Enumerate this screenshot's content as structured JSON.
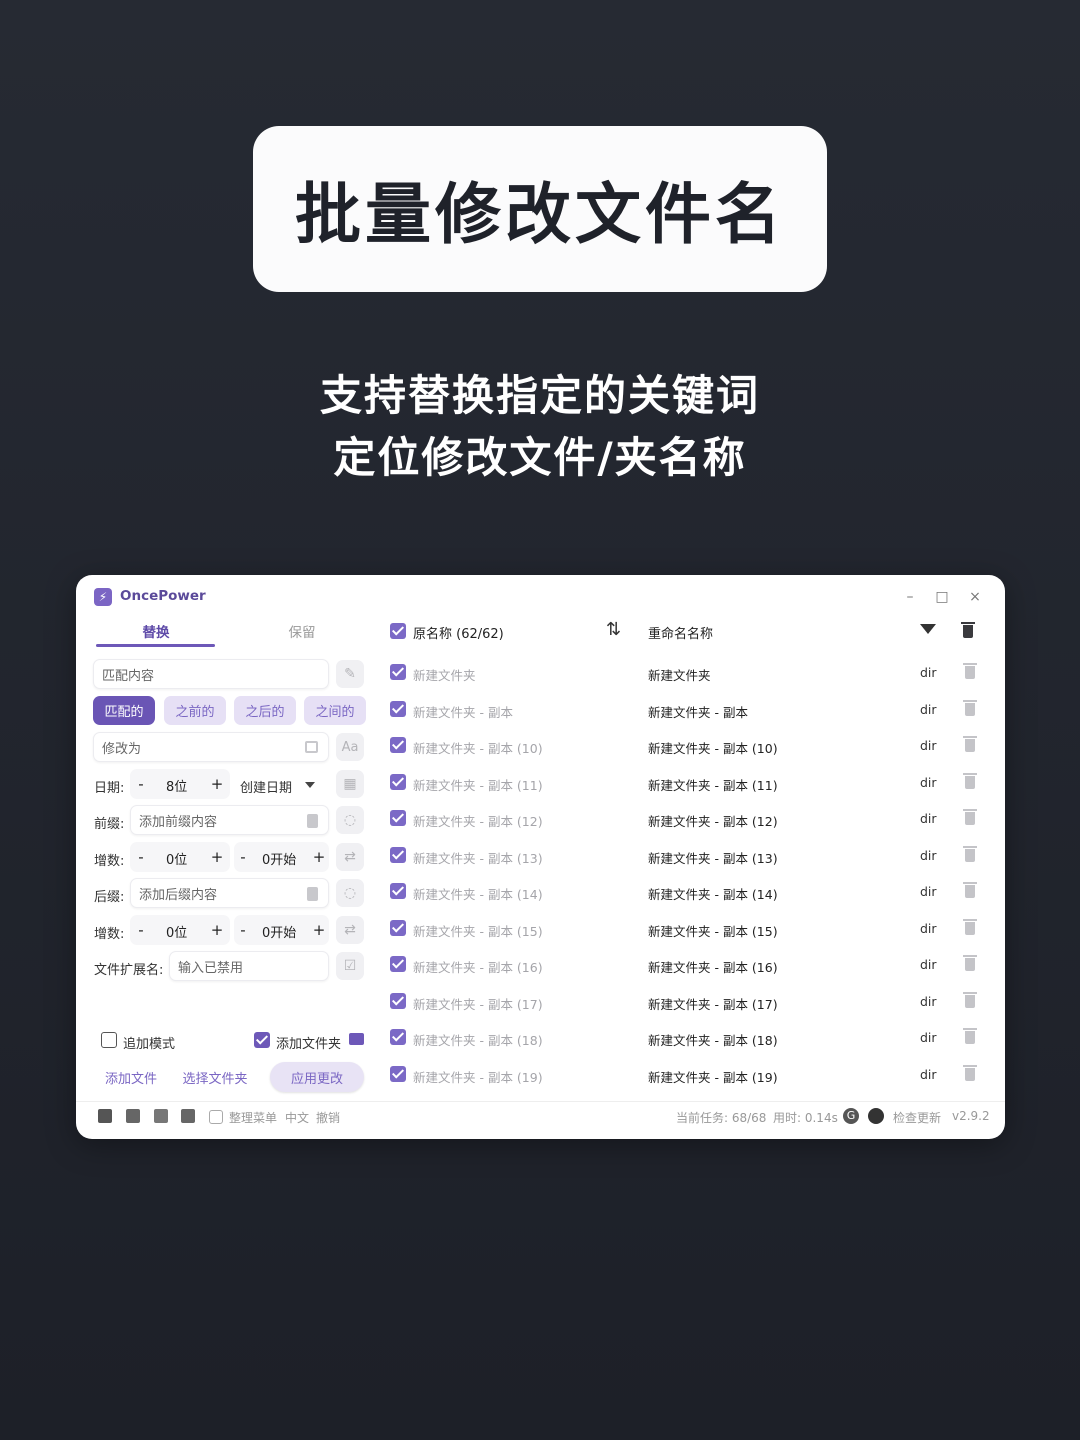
{
  "hero": {
    "title": "批量修改文件名"
  },
  "subtitle": {
    "line1": "支持替换指定的关键词",
    "line2": "定位修改文件/夹名称"
  },
  "app": {
    "name": "OncePower",
    "window_controls": {
      "minimize": "–",
      "maximize": "□",
      "close": "×"
    },
    "tabs": {
      "replace": "替换",
      "keep": "保留"
    },
    "match_input": {
      "placeholder": "匹配内容"
    },
    "segments": [
      "匹配的",
      "之前的",
      "之后的",
      "之间的"
    ],
    "modify_input": {
      "placeholder": "修改为"
    },
    "case_button": "Aa",
    "date": {
      "label": "日期:",
      "minus": "-",
      "value": "8位",
      "plus": "+",
      "select": "创建日期"
    },
    "prefix": {
      "label": "前缀:",
      "placeholder": "添加前缀内容"
    },
    "prefix_incr": {
      "label": "增数:",
      "minus": "-",
      "digits": "0位",
      "plus": "+",
      "minus2": "-",
      "start": "0开始",
      "plus2": "+"
    },
    "suffix": {
      "label": "后缀:",
      "placeholder": "添加后缀内容"
    },
    "suffix_incr": {
      "label": "增数:",
      "minus": "-",
      "digits": "0位",
      "plus": "+",
      "minus2": "-",
      "start": "0开始",
      "plus2": "+"
    },
    "extension": {
      "label": "文件扩展名:",
      "placeholder": "输入已禁用"
    },
    "append_mode": {
      "label": "追加模式",
      "checked": false
    },
    "add_folder": {
      "label": "添加文件夹",
      "checked": true
    },
    "buttons": {
      "add_file": "添加文件",
      "select_folder": "选择文件夹",
      "apply": "应用更改"
    },
    "list_header": {
      "original": "原名称 (62/62)",
      "renamed": "重命名名称"
    },
    "rows": [
      {
        "original": "新建文件夹",
        "renamed": "新建文件夹",
        "type": "dir"
      },
      {
        "original": "新建文件夹 - 副本",
        "renamed": "新建文件夹 - 副本",
        "type": "dir"
      },
      {
        "original": "新建文件夹 - 副本 (10)",
        "renamed": "新建文件夹 - 副本 (10)",
        "type": "dir"
      },
      {
        "original": "新建文件夹 - 副本 (11)",
        "renamed": "新建文件夹 - 副本 (11)",
        "type": "dir"
      },
      {
        "original": "新建文件夹 - 副本 (12)",
        "renamed": "新建文件夹 - 副本 (12)",
        "type": "dir"
      },
      {
        "original": "新建文件夹 - 副本 (13)",
        "renamed": "新建文件夹 - 副本 (13)",
        "type": "dir"
      },
      {
        "original": "新建文件夹 - 副本 (14)",
        "renamed": "新建文件夹 - 副本 (14)",
        "type": "dir"
      },
      {
        "original": "新建文件夹 - 副本 (15)",
        "renamed": "新建文件夹 - 副本 (15)",
        "type": "dir"
      },
      {
        "original": "新建文件夹 - 副本 (16)",
        "renamed": "新建文件夹 - 副本 (16)",
        "type": "dir"
      },
      {
        "original": "新建文件夹 - 副本 (17)",
        "renamed": "新建文件夹 - 副本 (17)",
        "type": "dir"
      },
      {
        "original": "新建文件夹 - 副本 (18)",
        "renamed": "新建文件夹 - 副本 (18)",
        "type": "dir"
      },
      {
        "original": "新建文件夹 - 副本 (19)",
        "renamed": "新建文件夹 - 副本 (19)",
        "type": "dir"
      }
    ],
    "status_bar": {
      "organize_menu": "整理菜单",
      "language": "中文",
      "undo": "撤销",
      "task": "当前任务: 68/68",
      "time": "用时: 0.14s",
      "check_update": "检查更新",
      "version": "v2.9.2"
    },
    "accent_color": "#6d58b8"
  }
}
